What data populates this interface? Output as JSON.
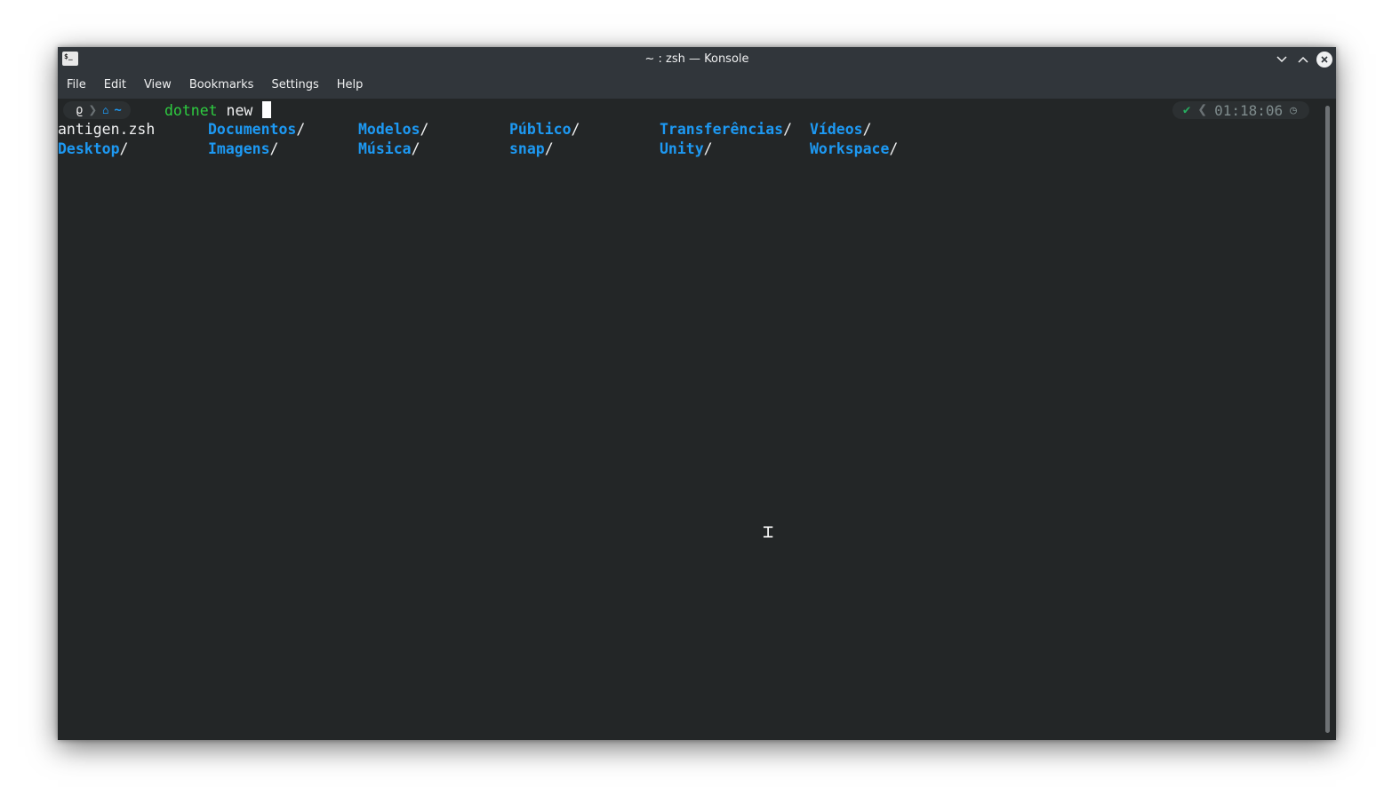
{
  "window": {
    "title": "~ : zsh — Konsole",
    "app_icon": "terminal-icon",
    "controls": [
      "minimize-chevron-icon",
      "maximize-chevron-icon",
      "close-icon"
    ]
  },
  "menubar": {
    "items": [
      "File",
      "Edit",
      "View",
      "Bookmarks",
      "Settings",
      "Help"
    ]
  },
  "prompt": {
    "os_icon": "distro-icon",
    "home_icon": "home-icon",
    "path": "~",
    "command_name": "dotnet",
    "command_args": "new",
    "status_icon": "checkmark-icon",
    "time": "01:18:06",
    "clock_icon": "clock-icon"
  },
  "listing": {
    "row1": [
      {
        "name": "antigen.zsh",
        "suffix": "",
        "type": "file"
      },
      {
        "name": "Documentos",
        "suffix": "/",
        "type": "dir"
      },
      {
        "name": "Modelos",
        "suffix": "/",
        "type": "dir"
      },
      {
        "name": "Público",
        "suffix": "/",
        "type": "dir"
      },
      {
        "name": "Transferências",
        "suffix": "/",
        "type": "dir"
      },
      {
        "name": "Vídeos",
        "suffix": "/",
        "type": "dir"
      }
    ],
    "row2": [
      {
        "name": "Desktop",
        "suffix": "/",
        "type": "dir"
      },
      {
        "name": "Imagens",
        "suffix": "/",
        "type": "dir"
      },
      {
        "name": "Música",
        "suffix": "/",
        "type": "dir"
      },
      {
        "name": "snap",
        "suffix": "/",
        "type": "dir"
      },
      {
        "name": "Unity",
        "suffix": "/",
        "type": "dir"
      },
      {
        "name": "Workspace",
        "suffix": "/",
        "type": "dir"
      }
    ]
  },
  "colors": {
    "background": "#232627",
    "chrome": "#31363b",
    "directory": "#1d99f3",
    "command": "#2ecc40",
    "text": "#eff0f1"
  }
}
